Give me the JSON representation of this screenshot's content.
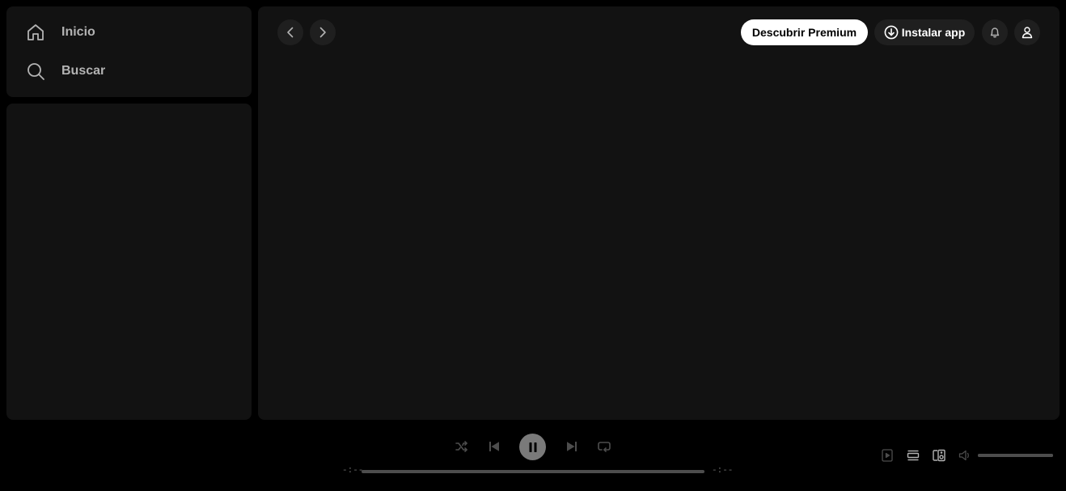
{
  "nav": {
    "items": [
      {
        "label": "Inicio",
        "icon": "home-icon"
      },
      {
        "label": "Buscar",
        "icon": "search-icon"
      }
    ]
  },
  "header": {
    "premium_label": "Descubrir Premium",
    "install_label": "Instalar app"
  },
  "player": {
    "elapsed": "-:--",
    "total": "-:--",
    "progress": 0,
    "volume": 1,
    "controls": [
      "shuffle-icon",
      "previous-icon",
      "pause-icon",
      "next-icon",
      "repeat-icon"
    ],
    "right_controls": [
      "now-playing-view-icon",
      "queue-icon",
      "connect-device-icon",
      "volume-icon"
    ]
  },
  "colors": {
    "background": "#000000",
    "panel": "#121212",
    "premium_button": "#ffffff",
    "muted_text": "#b3b3b3",
    "disabled_control": "#4d4d4d"
  }
}
